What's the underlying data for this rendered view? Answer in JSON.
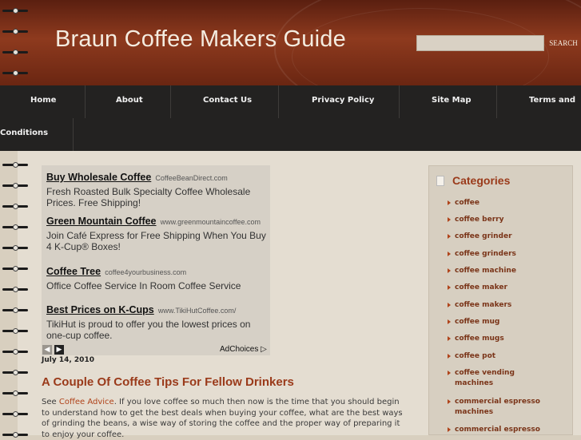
{
  "header": {
    "title": "Braun Coffee Makers Guide",
    "search_placeholder": "",
    "search_button": "SEARCH"
  },
  "nav": {
    "items": [
      "Home",
      "About",
      "Contact Us",
      "Privacy Policy",
      "Site Map",
      "Terms and",
      "Conditions"
    ]
  },
  "ads": [
    {
      "title": "Buy Wholesale Coffee",
      "url": "CoffeeBeanDirect.com",
      "text": "Fresh Roasted Bulk Specialty Coffee Wholesale Prices. Free Shipping!"
    },
    {
      "title": "Green Mountain Coffee",
      "url": "www.greenmountaincoffee.com",
      "text": "Join Café Express for Free Shipping When You Buy 4 K-Cup® Boxes!"
    },
    {
      "title": "Coffee Tree",
      "url": "coffee4yourbusiness.com",
      "text": "Office Coffee Service In Room Coffee Service"
    },
    {
      "title": "Best Prices on K-Cups",
      "url": "www.TikiHutCoffee.com/",
      "text": "TikiHut is proud to offer you the lowest prices on one-cup coffee."
    }
  ],
  "ad_controls": {
    "prev": "◀",
    "next": "▶",
    "adchoices": "AdChoices ▷"
  },
  "post": {
    "date": "July 14, 2010",
    "title": "A Couple Of Coffee Tips For Fellow Drinkers",
    "body_prefix": "See ",
    "link_text": "Coffee Advice",
    "body_rest": ". If you love coffee so much then now is the time that you should begin to understand how to get the best deals when buying your coffee, what are the best ways of grinding the beans, a wise way of storing the coffee and the proper way of preparing it to enjoy your coffee."
  },
  "sidebar": {
    "title": "Categories",
    "items": [
      "coffee",
      "coffee berry",
      "coffee grinder",
      "coffee grinders",
      "coffee machine",
      "coffee maker",
      "coffee makers",
      "coffee mug",
      "coffee mugs",
      "coffee pot",
      "coffee vending machines",
      "commercial espresso machines",
      "commercial espresso"
    ]
  },
  "colors": {
    "header": "#7a2e16",
    "nav": "#232221",
    "accent": "#9a3a1a",
    "link": "#b0431a"
  }
}
